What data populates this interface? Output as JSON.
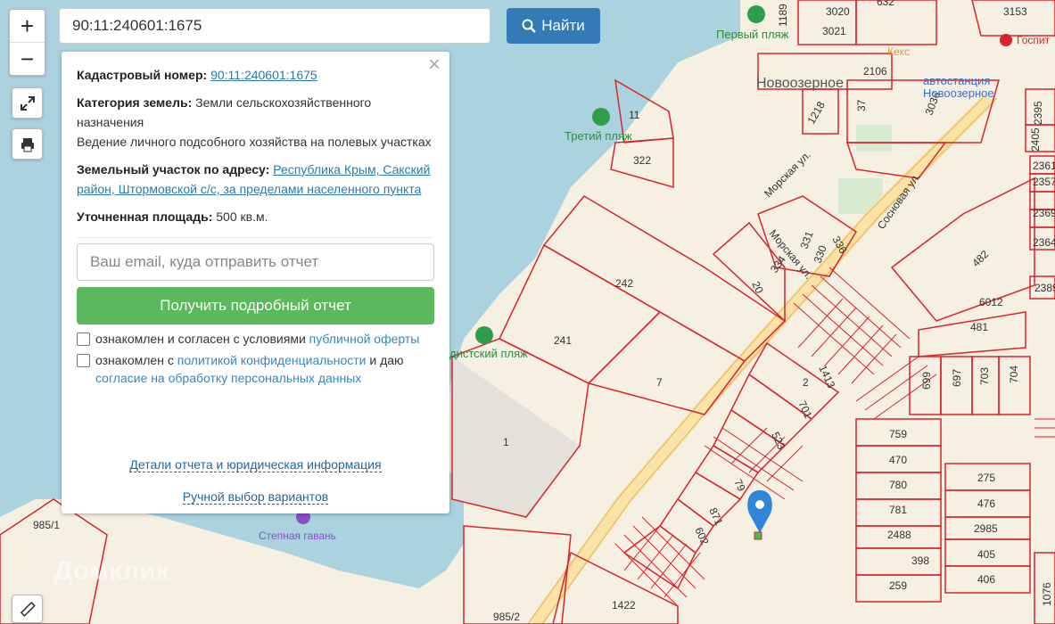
{
  "search": {
    "value": "90:11:240601:1675",
    "button": "Найти"
  },
  "zoom": {
    "in": "+",
    "out": "−"
  },
  "panel": {
    "close": "×",
    "cadastral_label": "Кадастровый номер:",
    "cadastral_value": "90:11:240601:1675",
    "category_label": "Категория земель:",
    "category_value": "Земли сельскохозяйственного назначения",
    "usage": "Ведение личного подсобного хозяйства на полевых участках",
    "address_label": "Земельный участок по адресу:",
    "address_value": "Республика Крым, Сакский район, Штормовской с/с, за пределами населенного пункта",
    "area_label": "Уточненная площадь:",
    "area_value": "500 кв.м.",
    "email_placeholder": "Ваш email, куда отправить отчет",
    "report_button": "Получить подробный отчет",
    "agree1_text": "ознакомлен и согласен с условиями ",
    "agree1_link": "публичной оферты",
    "agree2_text": "ознакомлен с ",
    "agree2_link": "политикой конфиденциальности",
    "agree2_mid": " и даю ",
    "agree2_link2": "согласие на обработку персональных данных",
    "details_link": "Детали отчета и юридическая информация",
    "manual_link": "Ручной выбор вариантов"
  },
  "map": {
    "places": {
      "settlement": "Новоозерное",
      "bus_station": "автостанция Новоозерное",
      "shop": "Кекс",
      "hospital": "Госпит"
    },
    "pois": {
      "beach1": "Первый пляж",
      "beach3": "Третий пляж",
      "beach_nudist": "дистский пляж",
      "harbor": "Степная гавань"
    },
    "streets": {
      "morskaya1": "Морская ул.",
      "morskaya2": "Морская ул.",
      "sosnovaya": "Сосновая ул."
    },
    "watermark": "Домклик",
    "parcels": [
      "3020",
      "3021",
      "632",
      "3153",
      "1189",
      "2106",
      "1218",
      "37",
      "3036",
      "2395",
      "2405",
      "2361",
      "2357",
      "2369",
      "2364",
      "11",
      "322",
      "331",
      "336",
      "330",
      "334",
      "20",
      "242",
      "241",
      "7",
      "1",
      "2",
      "1413",
      "701",
      "523",
      "79",
      "871",
      "602",
      "482",
      "6012",
      "481",
      "699",
      "697",
      "703",
      "704",
      "759",
      "470",
      "780",
      "781",
      "2488",
      "398",
      "259",
      "275",
      "476",
      "2985",
      "405",
      "406",
      "985/1",
      "985/2",
      "1422",
      "1076",
      "2389"
    ]
  }
}
